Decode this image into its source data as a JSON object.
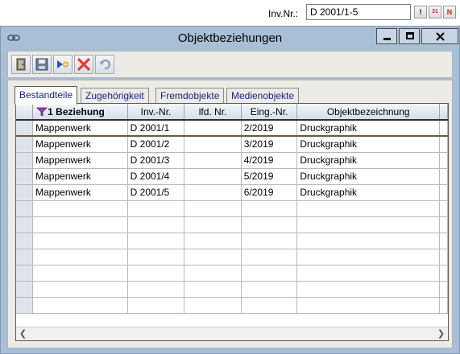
{
  "top": {
    "inv_label": "Inv.Nr.:",
    "inv_value": "D 2001/1-5",
    "buttons": [
      {
        "name": "exclamation-button",
        "glyph": "!"
      },
      {
        "name": "calendar-icon-button",
        "glyph": "31"
      },
      {
        "name": "n-button",
        "glyph": "N"
      }
    ]
  },
  "window": {
    "title": "Objektbeziehungen",
    "link_icon": "link-icon"
  },
  "toolbar": {
    "icons": [
      "exit-door-icon",
      "save-icon",
      "new-record-icon",
      "delete-icon",
      "undo-icon"
    ]
  },
  "tabs": [
    {
      "label": "Bestandteile",
      "active": true
    },
    {
      "label": "Zugehörigkeit",
      "active": false
    },
    {
      "label": "Fremdobjekte",
      "active": false
    },
    {
      "label": "Medienobjekte",
      "active": false
    }
  ],
  "grid": {
    "columns": [
      "1 Beziehung",
      "Inv.-Nr.",
      "lfd. Nr.",
      "Eing.-Nr.",
      "Objektbezeichnung"
    ],
    "sort_icon": "sort-funnel-icon",
    "rows": [
      [
        "Mappenwerk",
        "D 2001/1",
        "",
        "2/2019",
        "Druckgraphik"
      ],
      [
        "Mappenwerk",
        "D 2001/2",
        "",
        "3/2019",
        "Druckgraphik"
      ],
      [
        "Mappenwerk",
        "D 2001/3",
        "",
        "4/2019",
        "Druckgraphik"
      ],
      [
        "Mappenwerk",
        "D 2001/4",
        "",
        "5/2019",
        "Druckgraphik"
      ],
      [
        "Mappenwerk",
        "D 2001/5",
        "",
        "6/2019",
        "Druckgraphik"
      ]
    ],
    "empty_rows": 7
  },
  "colors": {
    "window_bg": "#a8bfd6",
    "panel_bg": "#ecebe6",
    "tab_text": "#1a237e",
    "close_red": "#c0392b"
  }
}
